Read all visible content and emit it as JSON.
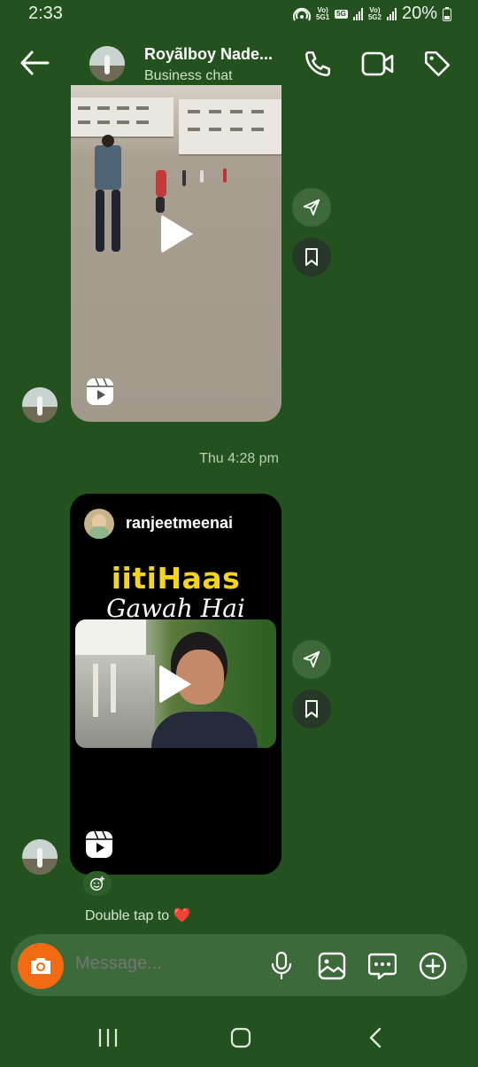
{
  "status_bar": {
    "time": "2:33",
    "net1_top": "Vo)",
    "net1_bottom": "5G1",
    "net_badge": "5G",
    "net2_top": "Vo)",
    "net2_bottom": "5G2",
    "battery": "20%"
  },
  "header": {
    "contact_name": "Royãlboy Nade...",
    "subtitle": "Business chat",
    "icons": [
      "back-arrow-icon",
      "phone-icon",
      "video-camera-icon",
      "tag-icon"
    ]
  },
  "messages": {
    "timestamp": "Thu 4:28 pm",
    "reel2": {
      "username": "ranjeetmeenai",
      "title_line1": "iitiHaas",
      "title_line2": "Gawah Hai"
    },
    "reaction_hint": "Double tap to",
    "reaction_emoji": "❤️"
  },
  "composer": {
    "placeholder": "Message..."
  },
  "colors": {
    "chat_background": "#23521f",
    "composer_background": "#3d6a3a",
    "camera_button": "#f26a12",
    "reel_title_yellow": "#f4d51c"
  }
}
